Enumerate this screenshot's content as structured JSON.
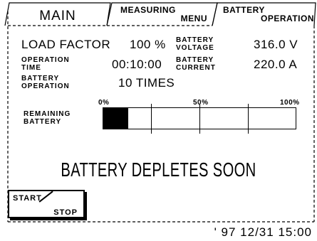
{
  "tabs": {
    "main": "MAIN",
    "measuring": [
      "MEASURING",
      "MENU"
    ],
    "battery": [
      "BATTERY",
      "OPERATION"
    ]
  },
  "readings": {
    "load_factor_label": "LOAD FACTOR",
    "load_factor_value": "100 %",
    "battery_voltage_label": [
      "BATTERY",
      "VOLTAGE"
    ],
    "battery_voltage_value": "316.0 V",
    "operation_time_label": [
      "OPERATION",
      "TIME"
    ],
    "operation_time_value": "00:10:00",
    "battery_current_label": [
      "BATTERY",
      "CURRENT"
    ],
    "battery_current_value": "220.0 A",
    "battery_operation_label": [
      "BATTERY",
      "OPERATION"
    ],
    "battery_operation_value": "10 TIMES"
  },
  "remaining": {
    "label": [
      "REMAINING",
      "BATTERY"
    ],
    "scale": [
      "0%",
      "50%",
      "100%"
    ],
    "level_fraction": 0.13
  },
  "warning": "BATTERY DEPLETES SOON",
  "button": {
    "line1": "START",
    "line2": "STOP"
  },
  "clock": "' 97 12/31 15:00"
}
